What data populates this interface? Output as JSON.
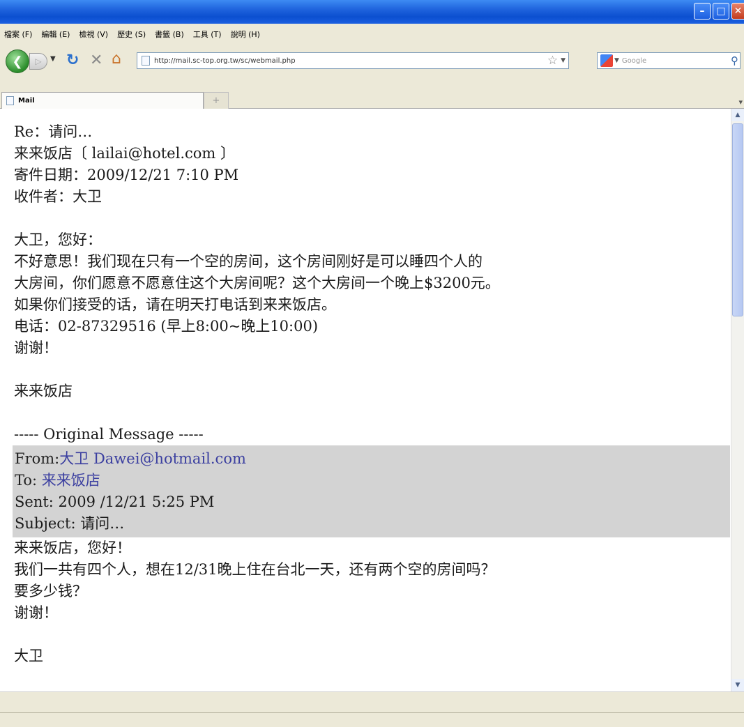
{
  "menu": [
    "檔案 (F)",
    "編輯 (E)",
    "檢視 (V)",
    "歷史 (S)",
    "書籤 (B)",
    "工具 (T)",
    "說明 (H)"
  ],
  "nav": {
    "url": "http://mail.sc-top.org.tw/sc/webmail.php",
    "search_placeholder": "Google"
  },
  "tab": {
    "label": "Mail"
  },
  "email": {
    "subject_line": "Re：请问…",
    "from_line": "来来饭店〔 lailai@hotel.com 〕",
    "date_line": "寄件日期：2009/12/21 7:10 PM",
    "to_line": "收件者：大卫",
    "body": [
      "大卫，您好：",
      "不好意思！我们现在只有一个空的房间，这个房间刚好是可以睡四个人的",
      "大房间，你们愿意不愿意住这个大房间呢？这个大房间一个晚上$3200元。",
      "如果你们接受的话，请在明天打电话到来来饭店。",
      "电话：02-87329516 (早上8:00~晚上10:00)",
      "谢谢！"
    ],
    "signature": "来来饭店",
    "divider": "----- Original Message -----",
    "original": {
      "from_label": "From:",
      "from_name": "大卫",
      "from_email": "Dawei@hotmail.com",
      "to_label": "To:",
      "to_value": "来来饭店",
      "sent": "Sent: 2009 /12/21   5:25 PM",
      "subject": "Subject: 请问…"
    },
    "original_body": [
      "来来饭店，您好！",
      "我们一共有四个人，想在12/31晚上住在台北一天，还有两个空的房间吗？",
      "要多少钱？",
      "谢谢！"
    ],
    "original_signature": "大卫"
  }
}
